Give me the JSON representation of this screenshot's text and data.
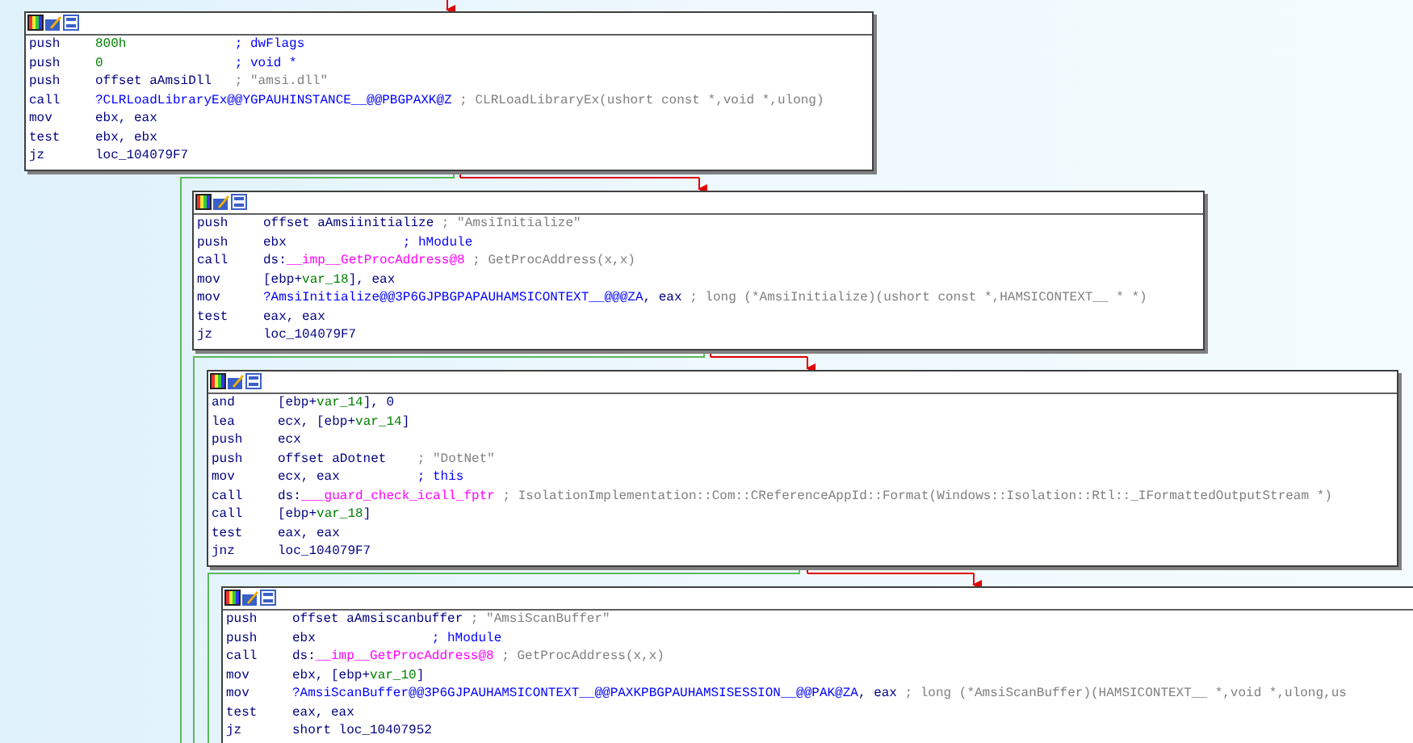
{
  "blocks": [
    {
      "lines": [
        {
          "mnemonic": "push",
          "operand": [
            {
              "text": "800h",
              "kind": "num"
            }
          ],
          "comment": {
            "text": "; dwFlags",
            "kind": "arg"
          }
        },
        {
          "mnemonic": "push",
          "operand": [
            {
              "text": "0",
              "kind": "num"
            }
          ],
          "comment": {
            "text": "; void *",
            "kind": "arg"
          }
        },
        {
          "mnemonic": "push",
          "operand": [
            {
              "text": "offset aAmsiDll",
              "kind": "plain"
            }
          ],
          "comment": {
            "text": "; \"amsi.dll\"",
            "kind": "auto"
          }
        },
        {
          "mnemonic": "call",
          "operand": [
            {
              "text": "?CLRLoadLibraryEx@@YGPAUHINSTANCE__@@PBGPAXK@Z",
              "kind": "name"
            }
          ],
          "comment": {
            "text": "; CLRLoadLibraryEx(ushort const *,void *,ulong)",
            "kind": "auto"
          }
        },
        {
          "mnemonic": "mov",
          "operand": [
            {
              "text": "ebx, eax",
              "kind": "plain"
            }
          ]
        },
        {
          "mnemonic": "test",
          "operand": [
            {
              "text": "ebx, ebx",
              "kind": "plain"
            }
          ]
        },
        {
          "mnemonic": "jz",
          "operand": [
            {
              "text": "loc_104079F7",
              "kind": "plain"
            }
          ]
        }
      ]
    },
    {
      "lines": [
        {
          "mnemonic": "push",
          "operand": [
            {
              "text": "offset aAmsiinitialize",
              "kind": "plain"
            }
          ],
          "comment": {
            "text": "; \"AmsiInitialize\"",
            "kind": "auto"
          }
        },
        {
          "mnemonic": "push",
          "operand": [
            {
              "text": "ebx",
              "kind": "plain"
            }
          ],
          "comment": {
            "text": "; hModule",
            "kind": "arg"
          }
        },
        {
          "mnemonic": "call",
          "operand": [
            {
              "text": "ds:",
              "kind": "plain"
            },
            {
              "text": "__imp__GetProcAddress@8",
              "kind": "import"
            }
          ],
          "comment": {
            "text": "; GetProcAddress(x,x)",
            "kind": "auto"
          }
        },
        {
          "mnemonic": "mov",
          "operand": [
            {
              "text": "[ebp+",
              "kind": "plain"
            },
            {
              "text": "var_18",
              "kind": "var"
            },
            {
              "text": "], eax",
              "kind": "plain"
            }
          ]
        },
        {
          "mnemonic": "mov",
          "operand": [
            {
              "text": "?AmsiInitialize@@3P6GJPBGPAPAUHAMSICONTEXT__@@@ZA",
              "kind": "name"
            },
            {
              "text": ", eax",
              "kind": "plain"
            }
          ],
          "comment": {
            "text": "; long (*AmsiInitialize)(ushort const *,HAMSICONTEXT__ * *)",
            "kind": "auto"
          }
        },
        {
          "mnemonic": "test",
          "operand": [
            {
              "text": "eax, eax",
              "kind": "plain"
            }
          ]
        },
        {
          "mnemonic": "jz",
          "operand": [
            {
              "text": "loc_104079F7",
              "kind": "plain"
            }
          ]
        }
      ]
    },
    {
      "lines": [
        {
          "mnemonic": "and",
          "operand": [
            {
              "text": "[ebp+",
              "kind": "plain"
            },
            {
              "text": "var_14",
              "kind": "var"
            },
            {
              "text": "], 0",
              "kind": "plain"
            }
          ]
        },
        {
          "mnemonic": "lea",
          "operand": [
            {
              "text": "ecx, [ebp+",
              "kind": "plain"
            },
            {
              "text": "var_14",
              "kind": "var"
            },
            {
              "text": "]",
              "kind": "plain"
            }
          ]
        },
        {
          "mnemonic": "push",
          "operand": [
            {
              "text": "ecx",
              "kind": "plain"
            }
          ]
        },
        {
          "mnemonic": "push",
          "operand": [
            {
              "text": "offset aDotnet",
              "kind": "plain"
            }
          ],
          "comment": {
            "text": "; \"DotNet\"",
            "kind": "auto"
          }
        },
        {
          "mnemonic": "mov",
          "operand": [
            {
              "text": "ecx, eax",
              "kind": "plain"
            }
          ],
          "comment": {
            "text": "; this",
            "kind": "arg"
          }
        },
        {
          "mnemonic": "call",
          "operand": [
            {
              "text": "ds:",
              "kind": "plain"
            },
            {
              "text": "___guard_check_icall_fptr",
              "kind": "import"
            }
          ],
          "comment": {
            "text": "; IsolationImplementation::Com::CReferenceAppId::Format(Windows::Isolation::Rtl::_IFormattedOutputStream *)",
            "kind": "auto"
          }
        },
        {
          "mnemonic": "call",
          "operand": [
            {
              "text": "[ebp+",
              "kind": "plain"
            },
            {
              "text": "var_18",
              "kind": "var"
            },
            {
              "text": "]",
              "kind": "plain"
            }
          ]
        },
        {
          "mnemonic": "test",
          "operand": [
            {
              "text": "eax, eax",
              "kind": "plain"
            }
          ]
        },
        {
          "mnemonic": "jnz",
          "operand": [
            {
              "text": "loc_104079F7",
              "kind": "plain"
            }
          ]
        }
      ]
    },
    {
      "lines": [
        {
          "mnemonic": "push",
          "operand": [
            {
              "text": "offset aAmsiscanbuffer",
              "kind": "plain"
            }
          ],
          "comment": {
            "text": "; \"AmsiScanBuffer\"",
            "kind": "auto"
          }
        },
        {
          "mnemonic": "push",
          "operand": [
            {
              "text": "ebx",
              "kind": "plain"
            }
          ],
          "comment": {
            "text": "; hModule",
            "kind": "arg"
          }
        },
        {
          "mnemonic": "call",
          "operand": [
            {
              "text": "ds:",
              "kind": "plain"
            },
            {
              "text": "__imp__GetProcAddress@8",
              "kind": "import"
            }
          ],
          "comment": {
            "text": "; GetProcAddress(x,x)",
            "kind": "auto"
          }
        },
        {
          "mnemonic": "mov",
          "operand": [
            {
              "text": "ebx, [ebp+",
              "kind": "plain"
            },
            {
              "text": "var_10",
              "kind": "var"
            },
            {
              "text": "]",
              "kind": "plain"
            }
          ]
        },
        {
          "mnemonic": "mov",
          "operand": [
            {
              "text": "?AmsiScanBuffer@@3P6GJPAUHAMSICONTEXT__@@PAXKPBGPAUHAMSISESSION__@@PAK@ZA",
              "kind": "name"
            },
            {
              "text": ", eax",
              "kind": "plain"
            }
          ],
          "comment": {
            "text": "; long (*AmsiScanBuffer)(HAMSICONTEXT__ *,void *,ulong,us",
            "kind": "auto"
          }
        },
        {
          "mnemonic": "test",
          "operand": [
            {
              "text": "eax, eax",
              "kind": "plain"
            }
          ]
        },
        {
          "mnemonic": "jz",
          "operand": [
            {
              "text": "short loc_10407952",
              "kind": "plain"
            }
          ]
        }
      ]
    }
  ]
}
